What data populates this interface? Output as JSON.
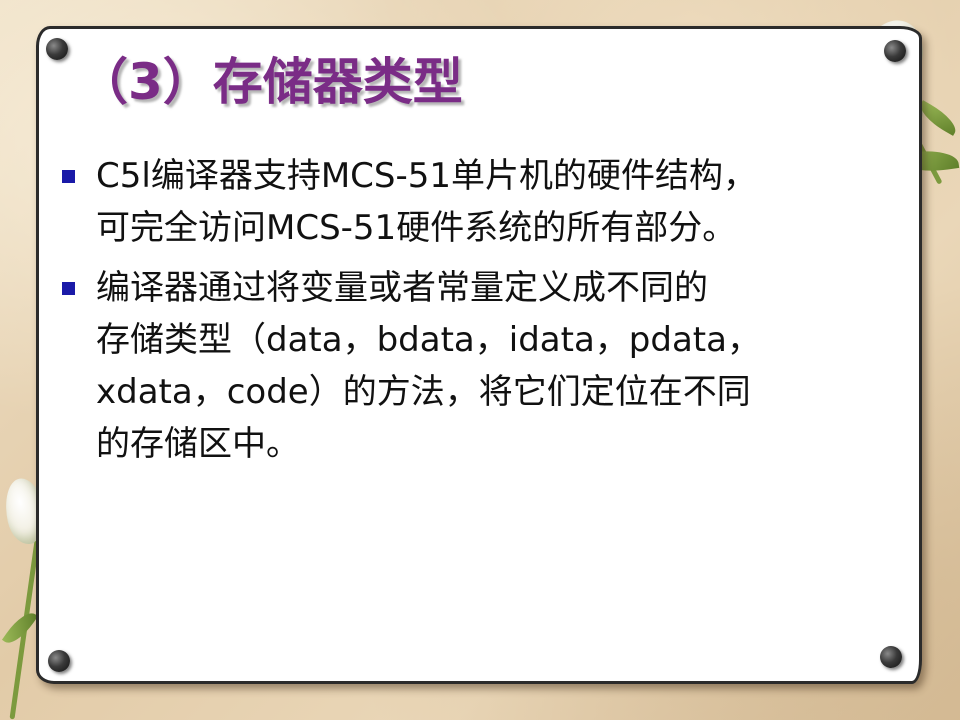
{
  "slide": {
    "title": "（3）存储器类型",
    "bullets": [
      {
        "lines": [
          "C5l编译器支持MCS-51单片机的硬件结构，",
          "可完全访问MCS-51硬件系统的所有部分。"
        ]
      },
      {
        "lines": [
          "编译器通过将变量或者常量定义成不同的",
          "存储类型（data，bdata，idata，pdata，",
          "xdata，code）的方法，将它们定位在不同",
          "的存储区中。"
        ]
      }
    ]
  },
  "colors": {
    "title": "#7a2c86",
    "bullet_marker": "#1a1aa8",
    "body_text": "#111111",
    "card_background": "#ffffff"
  },
  "icons": {
    "bullet": "square-bullet-icon",
    "pin": "pushpin-icon",
    "decoration": "tulip-flower-icon"
  }
}
